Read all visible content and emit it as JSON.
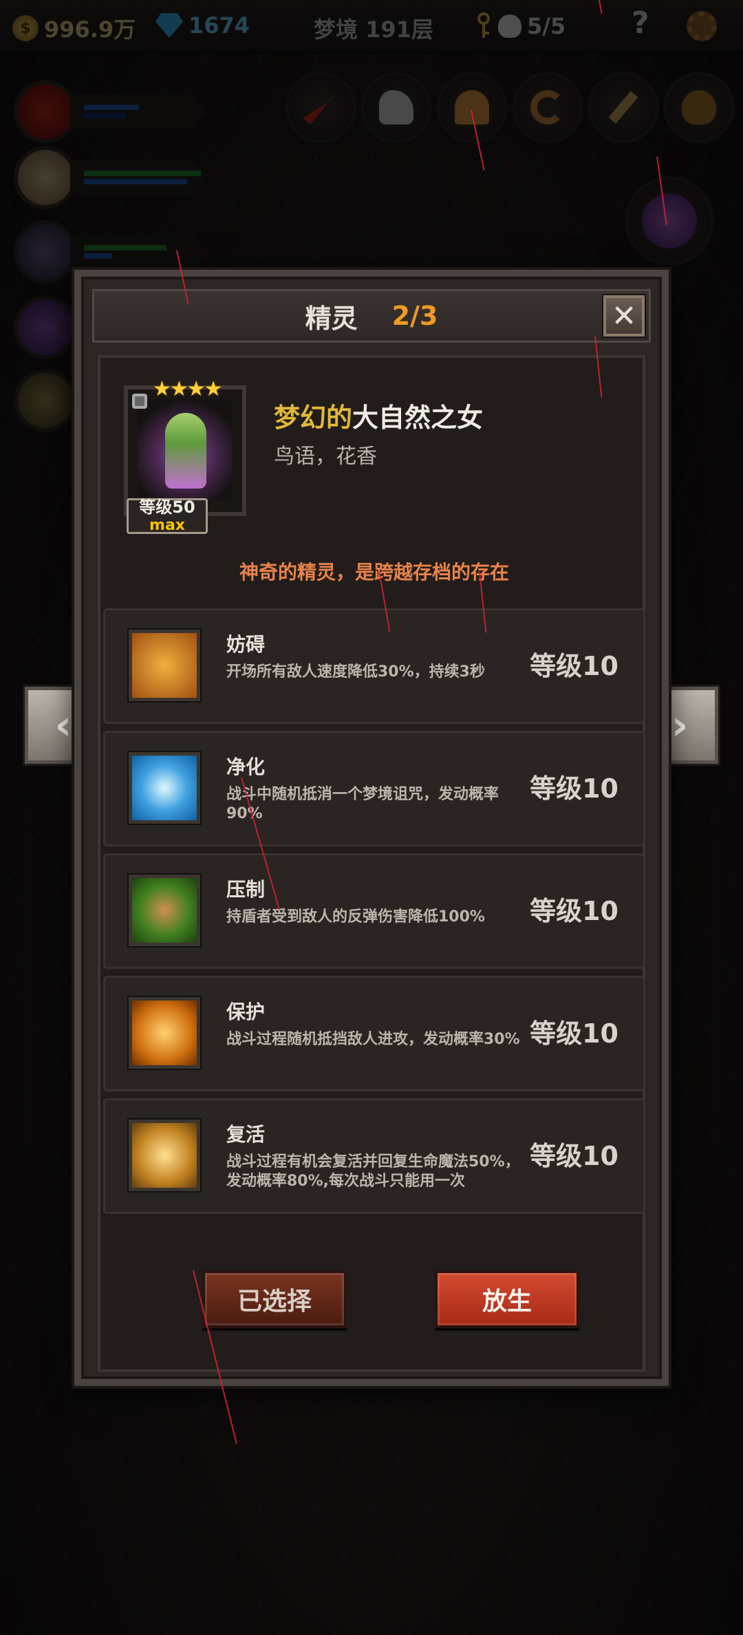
{
  "topbar": {
    "gold": "996.9万",
    "gems": "1674",
    "floor": "梦境 191层",
    "lives": "5/5",
    "help": "?"
  },
  "dialog": {
    "title": "精灵",
    "count": "2/3",
    "close": "✕"
  },
  "spirit": {
    "stars": "★★★★",
    "level": "等级50",
    "max": "max",
    "name_part1": "梦幻的",
    "name_part2": "大自然之女",
    "traits": "鸟语，花香",
    "description": "神奇的精灵，是跨越存档的存在"
  },
  "skills": [
    {
      "name": "妨碍",
      "desc": "开场所有敌人速度降低30%，持续3秒",
      "level": "等级10",
      "icon": "shackled-boot-icon"
    },
    {
      "name": "净化",
      "desc": "战斗中随机抵消一个梦境诅咒，发动概率90%",
      "level": "等级10",
      "icon": "blue-flower-icon"
    },
    {
      "name": "压制",
      "desc": "持盾者受到敌人的反弹伤害降低100%",
      "level": "等级10",
      "icon": "beast-claw-icon"
    },
    {
      "name": "保护",
      "desc": "战斗过程随机抵挡敌人进攻，发动概率30%",
      "level": "等级10",
      "icon": "fairy-guard-icon"
    },
    {
      "name": "复活",
      "desc": "战斗过程有机会复活并回复生命魔法50%，发动概率80%,每次战斗只能用一次",
      "level": "等级10",
      "icon": "dancing-fairy-icon"
    }
  ],
  "buttons": {
    "selected": "已选择",
    "release": "放生"
  },
  "nav": {
    "prev": "‹",
    "next": "›"
  },
  "colors": {
    "accent_orange": "#f09a28",
    "name_gold": "#e0b83a",
    "desc_orange": "#e8824a",
    "release_red": "#c83a22"
  }
}
